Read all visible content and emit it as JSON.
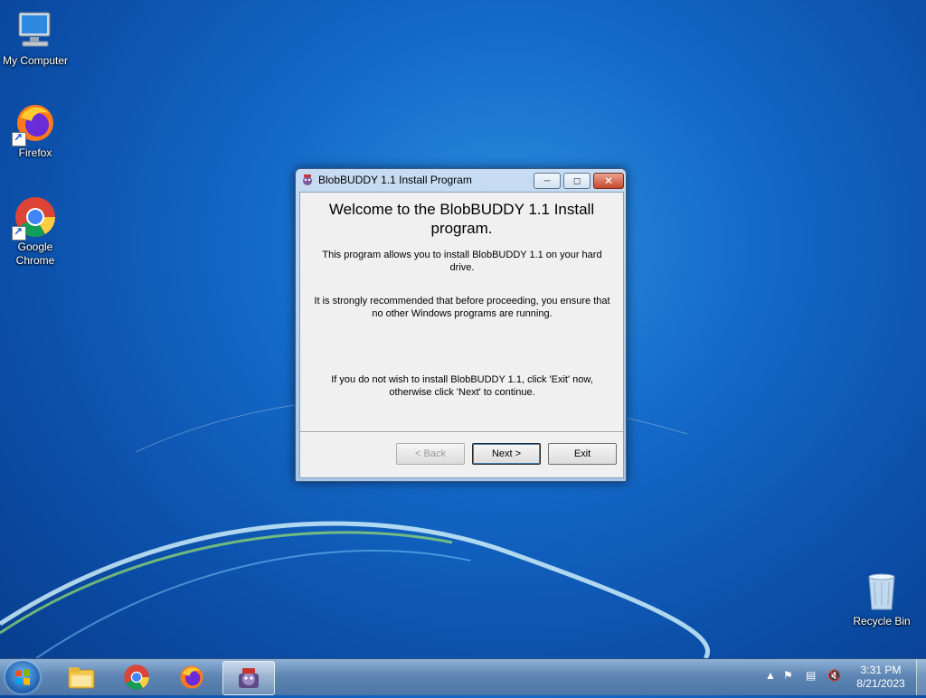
{
  "desktop": {
    "icons": [
      {
        "label": "My Computer"
      },
      {
        "label": "Firefox"
      },
      {
        "label": "Google Chrome"
      },
      {
        "label": "Recycle Bin"
      }
    ]
  },
  "window": {
    "title": "BlobBUDDY 1.1 Install Program",
    "heading": "Welcome to the BlobBUDDY 1.1 Install program.",
    "paragraph1": "This program allows you to install BlobBUDDY 1.1 on your hard drive.",
    "paragraph2": "It is strongly recommended that before proceeding, you ensure that no other Windows programs are running.",
    "paragraph3": "If you do not wish to install BlobBUDDY 1.1, click 'Exit' now, otherwise click 'Next' to continue.",
    "buttons": {
      "back": "< Back",
      "next": "Next >",
      "exit": "Exit"
    }
  },
  "taskbar": {
    "pinned": [
      "windows-explorer-icon",
      "chrome-icon",
      "firefox-icon",
      "blobbuddy-installer-icon"
    ],
    "clock": {
      "time": "3:31 PM",
      "date": "8/21/2023"
    }
  },
  "colors": {
    "desktop_blue": "#1469c8",
    "window_frame": "#a9c6e6",
    "close_red": "#c7472e"
  }
}
